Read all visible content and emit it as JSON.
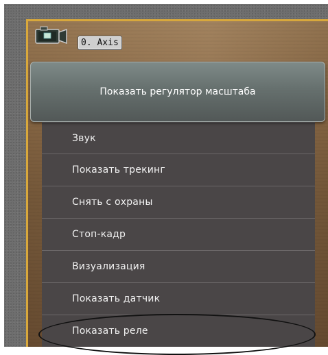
{
  "camera": {
    "label": "0. Axis",
    "icon": "camera-icon"
  },
  "menu": {
    "top_item": "Показать регулятор масштаба",
    "items": [
      {
        "label": "Звук"
      },
      {
        "label": "Показать трекинг"
      },
      {
        "label": "Снять с охраны"
      },
      {
        "label": "Стоп-кадр"
      },
      {
        "label": "Визуализация"
      },
      {
        "label": "Показать датчик"
      },
      {
        "label": "Показать реле"
      }
    ]
  },
  "colors": {
    "frame_accent": "#d8a83c",
    "menu_bg": "#4a4647",
    "highlight": "#111111"
  }
}
